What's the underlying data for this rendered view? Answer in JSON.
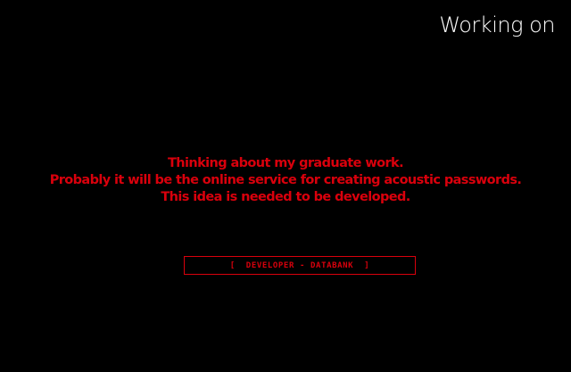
{
  "header": {
    "title": "Working on"
  },
  "message": {
    "lines": [
      "Thinking about my graduate work.",
      "Probably it will be the online service for creating acoustic passwords.",
      "This idea is needed to be developed."
    ]
  },
  "link": {
    "label": "[  DEVELOPER - DATABANK  ]"
  },
  "colors": {
    "background": "#000000",
    "heading": "#ffffff",
    "accent": "#d9000c"
  }
}
